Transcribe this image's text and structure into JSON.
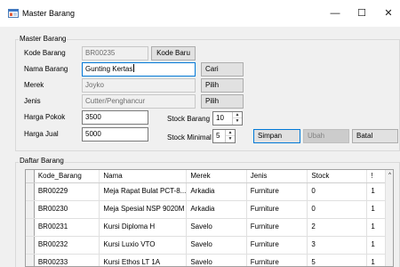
{
  "window": {
    "title": "Master Barang",
    "minimize": "—",
    "maximize": "☐",
    "close": "✕"
  },
  "form": {
    "group_title": "Master Barang",
    "kode_label": "Kode Barang",
    "kode_value": "BR00235",
    "kode_baru_button": "Kode Baru",
    "nama_label": "Nama Barang",
    "nama_value": "Gunting Kertas",
    "cari_button": "Cari",
    "merek_label": "Merek",
    "merek_value": "Joyko",
    "merek_pilih_button": "Pilih",
    "jenis_label": "Jenis",
    "jenis_value": "Cutter/Penghancur",
    "jenis_pilih_button": "Pilih",
    "harga_pokok_label": "Harga Pokok",
    "harga_pokok_value": "3500",
    "stock_barang_label": "Stock Barang",
    "stock_barang_value": "10",
    "harga_jual_label": "Harga Jual",
    "harga_jual_value": "5000",
    "stock_minimal_label": "Stock Minimal",
    "stock_minimal_value": "5",
    "simpan_button": "Simpan",
    "ubah_button": "Ubah",
    "batal_button": "Batal"
  },
  "list": {
    "group_title": "Daftar Barang",
    "columns": [
      "Kode_Barang",
      "Nama",
      "Merek",
      "Jenis",
      "Stock",
      "!"
    ],
    "rows": [
      [
        "BR00229",
        "Meja Rapat Bulat PCT-8...",
        "Arkadia",
        "Furniture",
        "0",
        "1"
      ],
      [
        "BR00230",
        "Meja Spesial NSP 9020M",
        "Arkadia",
        "Furniture",
        "0",
        "1"
      ],
      [
        "BR00231",
        "Kursi Diploma H",
        "Savelo",
        "Furniture",
        "2",
        "1"
      ],
      [
        "BR00232",
        "Kursi Luxio VTO",
        "Savelo",
        "Furniture",
        "3",
        "1"
      ],
      [
        "BR00233",
        "Kursi Ethos LT 1A",
        "Savelo",
        "Furniture",
        "5",
        "1"
      ]
    ]
  },
  "icons": {
    "app": "app-form-icon",
    "spin_up": "▲",
    "spin_down": "▼",
    "scroll_up": "^"
  }
}
